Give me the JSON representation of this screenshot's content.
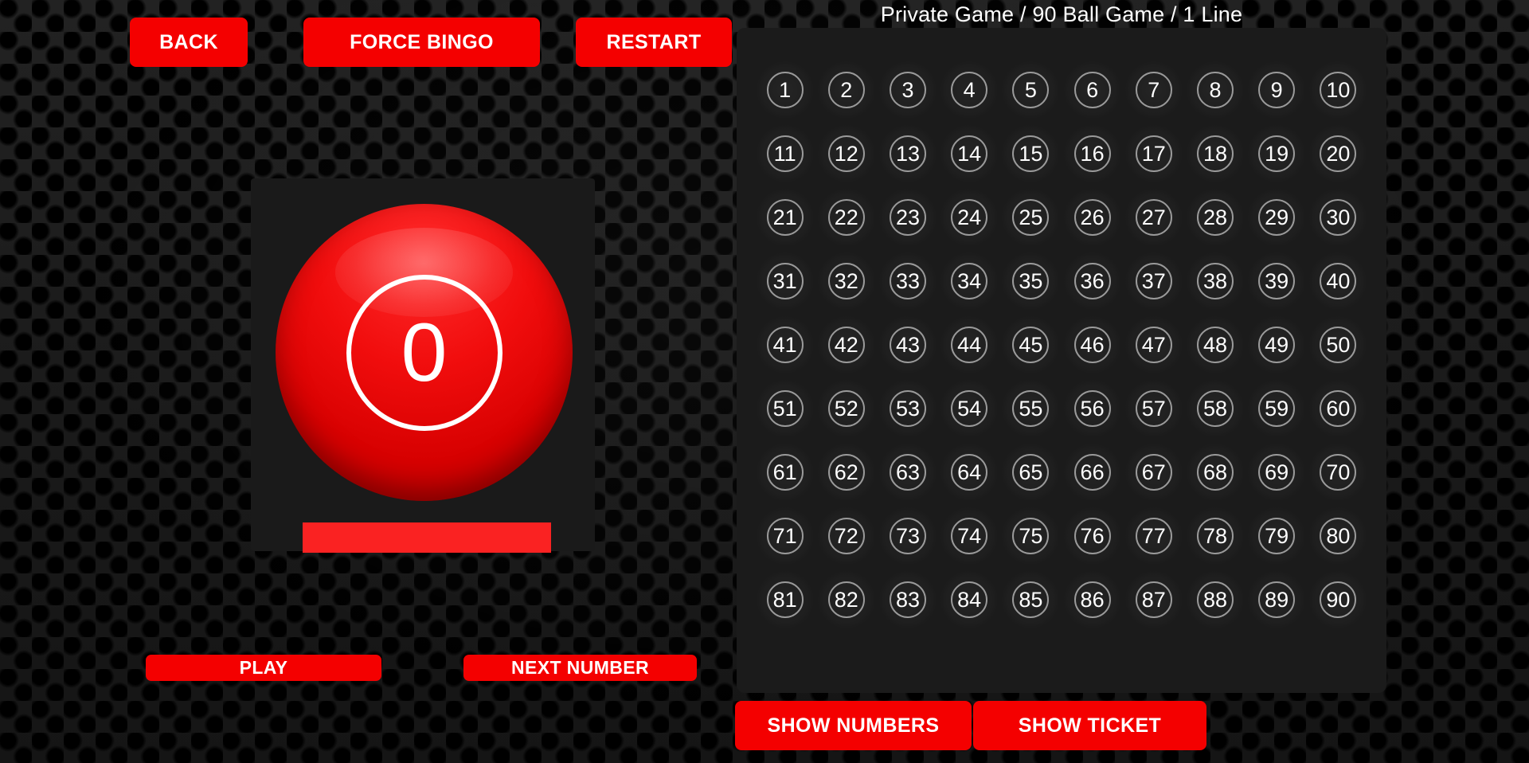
{
  "theme": {
    "accent_red": "#f40000",
    "progress_red": "#fa2222",
    "panel_bg": "#1b1b1b",
    "stage_bg": "#1a1a1a",
    "text_white": "#ffffff",
    "ring_gray": "#9a9a9a"
  },
  "header": {
    "title": "Private Game / 90 Ball Game / 1 Line"
  },
  "toolbar": {
    "back_label": "BACK",
    "force_bingo_label": "FORCE BINGO",
    "restart_label": "RESTART"
  },
  "ball_display": {
    "current_number": "0",
    "progress_percent": 100
  },
  "play_controls": {
    "play_label": "PLAY",
    "next_number_label": "NEXT NUMBER"
  },
  "number_board": {
    "columns": 10,
    "rows": 9,
    "numbers": [
      "1",
      "2",
      "3",
      "4",
      "5",
      "6",
      "7",
      "8",
      "9",
      "10",
      "11",
      "12",
      "13",
      "14",
      "15",
      "16",
      "17",
      "18",
      "19",
      "20",
      "21",
      "22",
      "23",
      "24",
      "25",
      "26",
      "27",
      "28",
      "29",
      "30",
      "31",
      "32",
      "33",
      "34",
      "35",
      "36",
      "37",
      "38",
      "39",
      "40",
      "41",
      "42",
      "43",
      "44",
      "45",
      "46",
      "47",
      "48",
      "49",
      "50",
      "51",
      "52",
      "53",
      "54",
      "55",
      "56",
      "57",
      "58",
      "59",
      "60",
      "61",
      "62",
      "63",
      "64",
      "65",
      "66",
      "67",
      "68",
      "69",
      "70",
      "71",
      "72",
      "73",
      "74",
      "75",
      "76",
      "77",
      "78",
      "79",
      "80",
      "81",
      "82",
      "83",
      "84",
      "85",
      "86",
      "87",
      "88",
      "89",
      "90"
    ],
    "called_numbers": []
  },
  "bottom_bar": {
    "show_numbers_label": "SHOW NUMBERS",
    "show_ticket_label": "SHOW TICKET"
  }
}
